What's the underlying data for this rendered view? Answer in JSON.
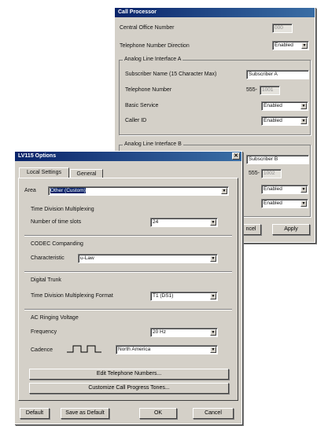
{
  "call_processor": {
    "title": "Call Processor",
    "rows": {
      "co_number_label": "Central Office Number",
      "co_number_value": "000",
      "tel_direction_label": "Telephone Number Direction",
      "tel_direction_value": "Enabled"
    },
    "group_a": {
      "label": "Analog Line Interface A",
      "subscriber_label": "Subscriber Name (15 Character Max)",
      "subscriber_value": "Subscriber A",
      "telnum_label": "Telephone Number",
      "telnum_prefix": "555-",
      "telnum_value": "1001",
      "basic_label": "Basic Service",
      "basic_value": "Enabled",
      "callerid_label": "Caller ID",
      "callerid_value": "Enabled"
    },
    "group_b": {
      "label": "Analog Line Interface B",
      "subscriber_value": "Subscriber B",
      "telnum_prefix": "555-",
      "telnum_value": "1002",
      "basic_value": "Enabled",
      "callerid_value": "Enabled"
    },
    "buttons": {
      "cancel": "ncel",
      "apply": "Apply"
    }
  },
  "options": {
    "title": "LV115 Options",
    "tabs": [
      "Local Settings",
      "General"
    ],
    "area_label": "Area",
    "area_value": "Other (Custom)",
    "tdm": {
      "heading": "Time Division Multiplexing",
      "label": "Number of time slots",
      "value": "24"
    },
    "codec": {
      "heading": "CODEC Companding",
      "label": "Characteristic",
      "value": "u-Law"
    },
    "digital": {
      "heading": "Digital Trunk",
      "label": "Time Division Multiplexing Format",
      "value": "T1 (DS1)"
    },
    "ringing": {
      "heading": "AC Ringing Voltage",
      "freq_label": "Frequency",
      "freq_value": "20 Hz",
      "cadence_label": "Cadence",
      "cadence_value": "North America"
    },
    "wide_buttons": {
      "edit": "Edit Telephone Numbers...",
      "customize": "Customize Call Progress Tones..."
    },
    "buttons": {
      "default": "Default",
      "save_default": "Save as Default",
      "ok": "OK",
      "cancel": "Cancel"
    }
  }
}
